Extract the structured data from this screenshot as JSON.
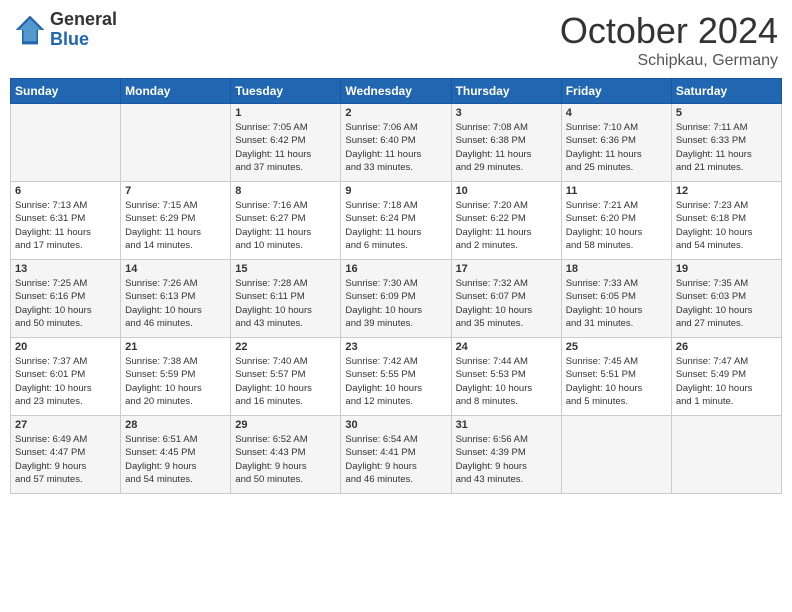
{
  "header": {
    "logo_general": "General",
    "logo_blue": "Blue",
    "title": "October 2024",
    "location": "Schipkau, Germany"
  },
  "days_of_week": [
    "Sunday",
    "Monday",
    "Tuesday",
    "Wednesday",
    "Thursday",
    "Friday",
    "Saturday"
  ],
  "weeks": [
    {
      "days": [
        {
          "number": "",
          "info": ""
        },
        {
          "number": "",
          "info": ""
        },
        {
          "number": "1",
          "info": "Sunrise: 7:05 AM\nSunset: 6:42 PM\nDaylight: 11 hours\nand 37 minutes."
        },
        {
          "number": "2",
          "info": "Sunrise: 7:06 AM\nSunset: 6:40 PM\nDaylight: 11 hours\nand 33 minutes."
        },
        {
          "number": "3",
          "info": "Sunrise: 7:08 AM\nSunset: 6:38 PM\nDaylight: 11 hours\nand 29 minutes."
        },
        {
          "number": "4",
          "info": "Sunrise: 7:10 AM\nSunset: 6:36 PM\nDaylight: 11 hours\nand 25 minutes."
        },
        {
          "number": "5",
          "info": "Sunrise: 7:11 AM\nSunset: 6:33 PM\nDaylight: 11 hours\nand 21 minutes."
        }
      ]
    },
    {
      "days": [
        {
          "number": "6",
          "info": "Sunrise: 7:13 AM\nSunset: 6:31 PM\nDaylight: 11 hours\nand 17 minutes."
        },
        {
          "number": "7",
          "info": "Sunrise: 7:15 AM\nSunset: 6:29 PM\nDaylight: 11 hours\nand 14 minutes."
        },
        {
          "number": "8",
          "info": "Sunrise: 7:16 AM\nSunset: 6:27 PM\nDaylight: 11 hours\nand 10 minutes."
        },
        {
          "number": "9",
          "info": "Sunrise: 7:18 AM\nSunset: 6:24 PM\nDaylight: 11 hours\nand 6 minutes."
        },
        {
          "number": "10",
          "info": "Sunrise: 7:20 AM\nSunset: 6:22 PM\nDaylight: 11 hours\nand 2 minutes."
        },
        {
          "number": "11",
          "info": "Sunrise: 7:21 AM\nSunset: 6:20 PM\nDaylight: 10 hours\nand 58 minutes."
        },
        {
          "number": "12",
          "info": "Sunrise: 7:23 AM\nSunset: 6:18 PM\nDaylight: 10 hours\nand 54 minutes."
        }
      ]
    },
    {
      "days": [
        {
          "number": "13",
          "info": "Sunrise: 7:25 AM\nSunset: 6:16 PM\nDaylight: 10 hours\nand 50 minutes."
        },
        {
          "number": "14",
          "info": "Sunrise: 7:26 AM\nSunset: 6:13 PM\nDaylight: 10 hours\nand 46 minutes."
        },
        {
          "number": "15",
          "info": "Sunrise: 7:28 AM\nSunset: 6:11 PM\nDaylight: 10 hours\nand 43 minutes."
        },
        {
          "number": "16",
          "info": "Sunrise: 7:30 AM\nSunset: 6:09 PM\nDaylight: 10 hours\nand 39 minutes."
        },
        {
          "number": "17",
          "info": "Sunrise: 7:32 AM\nSunset: 6:07 PM\nDaylight: 10 hours\nand 35 minutes."
        },
        {
          "number": "18",
          "info": "Sunrise: 7:33 AM\nSunset: 6:05 PM\nDaylight: 10 hours\nand 31 minutes."
        },
        {
          "number": "19",
          "info": "Sunrise: 7:35 AM\nSunset: 6:03 PM\nDaylight: 10 hours\nand 27 minutes."
        }
      ]
    },
    {
      "days": [
        {
          "number": "20",
          "info": "Sunrise: 7:37 AM\nSunset: 6:01 PM\nDaylight: 10 hours\nand 23 minutes."
        },
        {
          "number": "21",
          "info": "Sunrise: 7:38 AM\nSunset: 5:59 PM\nDaylight: 10 hours\nand 20 minutes."
        },
        {
          "number": "22",
          "info": "Sunrise: 7:40 AM\nSunset: 5:57 PM\nDaylight: 10 hours\nand 16 minutes."
        },
        {
          "number": "23",
          "info": "Sunrise: 7:42 AM\nSunset: 5:55 PM\nDaylight: 10 hours\nand 12 minutes."
        },
        {
          "number": "24",
          "info": "Sunrise: 7:44 AM\nSunset: 5:53 PM\nDaylight: 10 hours\nand 8 minutes."
        },
        {
          "number": "25",
          "info": "Sunrise: 7:45 AM\nSunset: 5:51 PM\nDaylight: 10 hours\nand 5 minutes."
        },
        {
          "number": "26",
          "info": "Sunrise: 7:47 AM\nSunset: 5:49 PM\nDaylight: 10 hours\nand 1 minute."
        }
      ]
    },
    {
      "days": [
        {
          "number": "27",
          "info": "Sunrise: 6:49 AM\nSunset: 4:47 PM\nDaylight: 9 hours\nand 57 minutes."
        },
        {
          "number": "28",
          "info": "Sunrise: 6:51 AM\nSunset: 4:45 PM\nDaylight: 9 hours\nand 54 minutes."
        },
        {
          "number": "29",
          "info": "Sunrise: 6:52 AM\nSunset: 4:43 PM\nDaylight: 9 hours\nand 50 minutes."
        },
        {
          "number": "30",
          "info": "Sunrise: 6:54 AM\nSunset: 4:41 PM\nDaylight: 9 hours\nand 46 minutes."
        },
        {
          "number": "31",
          "info": "Sunrise: 6:56 AM\nSunset: 4:39 PM\nDaylight: 9 hours\nand 43 minutes."
        },
        {
          "number": "",
          "info": ""
        },
        {
          "number": "",
          "info": ""
        }
      ]
    }
  ]
}
